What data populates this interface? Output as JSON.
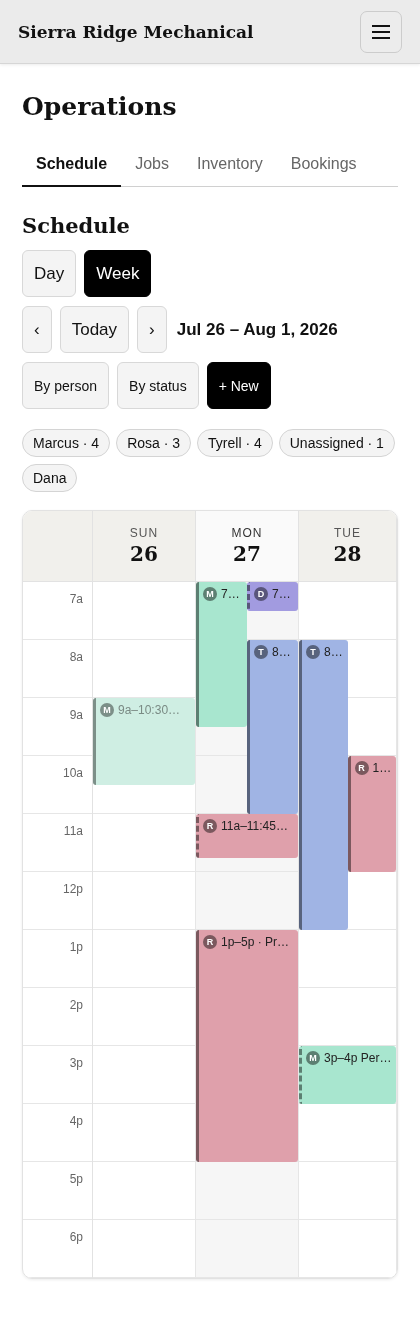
{
  "app_bar": {
    "title": "Sierra Ridge Mechanical"
  },
  "page_title": "Operations",
  "tabs": [
    {
      "label": "Schedule",
      "selected": true
    },
    {
      "label": "Jobs",
      "selected": false
    },
    {
      "label": "Inventory",
      "selected": false
    },
    {
      "label": "Bookings",
      "selected": false
    }
  ],
  "section_title": "Schedule",
  "views": [
    {
      "label": "Day",
      "selected": false
    },
    {
      "label": "Week",
      "selected": true
    }
  ],
  "nav": {
    "prev": "‹",
    "today": "Today",
    "next": "›",
    "range": "Jul 26 – Aug 1, 2026"
  },
  "actions": [
    {
      "label": "By person",
      "kind": "plain"
    },
    {
      "label": "By status",
      "kind": "plain"
    },
    {
      "label": "+ New",
      "kind": "primary"
    }
  ],
  "people_chips": [
    "Marcus · 4",
    "Rosa · 3",
    "Tyrell · 4",
    "Unassigned · 1",
    "Dana"
  ],
  "calendar": {
    "hours": [
      "7a",
      "8a",
      "9a",
      "10a",
      "11a",
      "12p",
      "1p",
      "2p",
      "3p",
      "4p",
      "5p",
      "6p"
    ],
    "days": [
      {
        "dow": "SUN",
        "date": "26",
        "today": false,
        "events": [
          {
            "initial": "M",
            "label": "9a–10:30…",
            "color": "#cfeee3",
            "faded": true,
            "dashed": false
          }
        ]
      },
      {
        "dow": "MON",
        "date": "27",
        "today": true,
        "events": [
          {
            "initial": "M",
            "label": "7…",
            "color": "#a8e6cf",
            "faded": false,
            "dashed": false
          },
          {
            "initial": "D",
            "label": "7…",
            "color": "#a29be0",
            "faded": false,
            "dashed": true
          },
          {
            "initial": "T",
            "label": "8…",
            "color": "#a0b4e4",
            "faded": false,
            "dashed": false
          },
          {
            "initial": "R",
            "label": "11a–11:45…",
            "color": "#dfa0ab",
            "faded": false,
            "dashed": true
          },
          {
            "initial": "R",
            "label": "1p–5p · Pr…",
            "color": "#dfa0ab",
            "faded": false,
            "dashed": false
          }
        ]
      },
      {
        "dow": "TUE",
        "date": "28",
        "today": false,
        "events": [
          {
            "initial": "T",
            "label": "8…",
            "color": "#a0b4e4",
            "faded": false,
            "dashed": false
          },
          {
            "initial": "R",
            "label": "1…",
            "color": "#dfa0ab",
            "faded": false,
            "dashed": false
          },
          {
            "initial": "M",
            "label": "3p–4p Per…",
            "color": "#a8e6cf",
            "faded": false,
            "dashed": true
          }
        ]
      }
    ]
  }
}
